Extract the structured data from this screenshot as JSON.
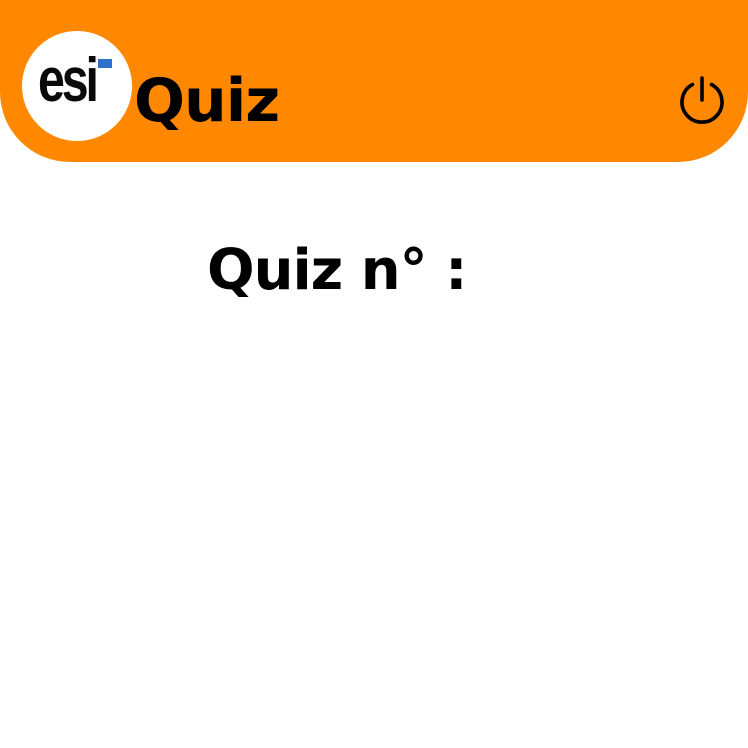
{
  "theme": {
    "header_color": "#FF8800",
    "text_color": "#000000",
    "logo_accent_color": "#2F6FCF"
  },
  "header": {
    "logo_text": "esi",
    "title": "Quiz",
    "power_icon": "power-icon"
  },
  "main": {
    "heading": "Quiz n° :"
  }
}
